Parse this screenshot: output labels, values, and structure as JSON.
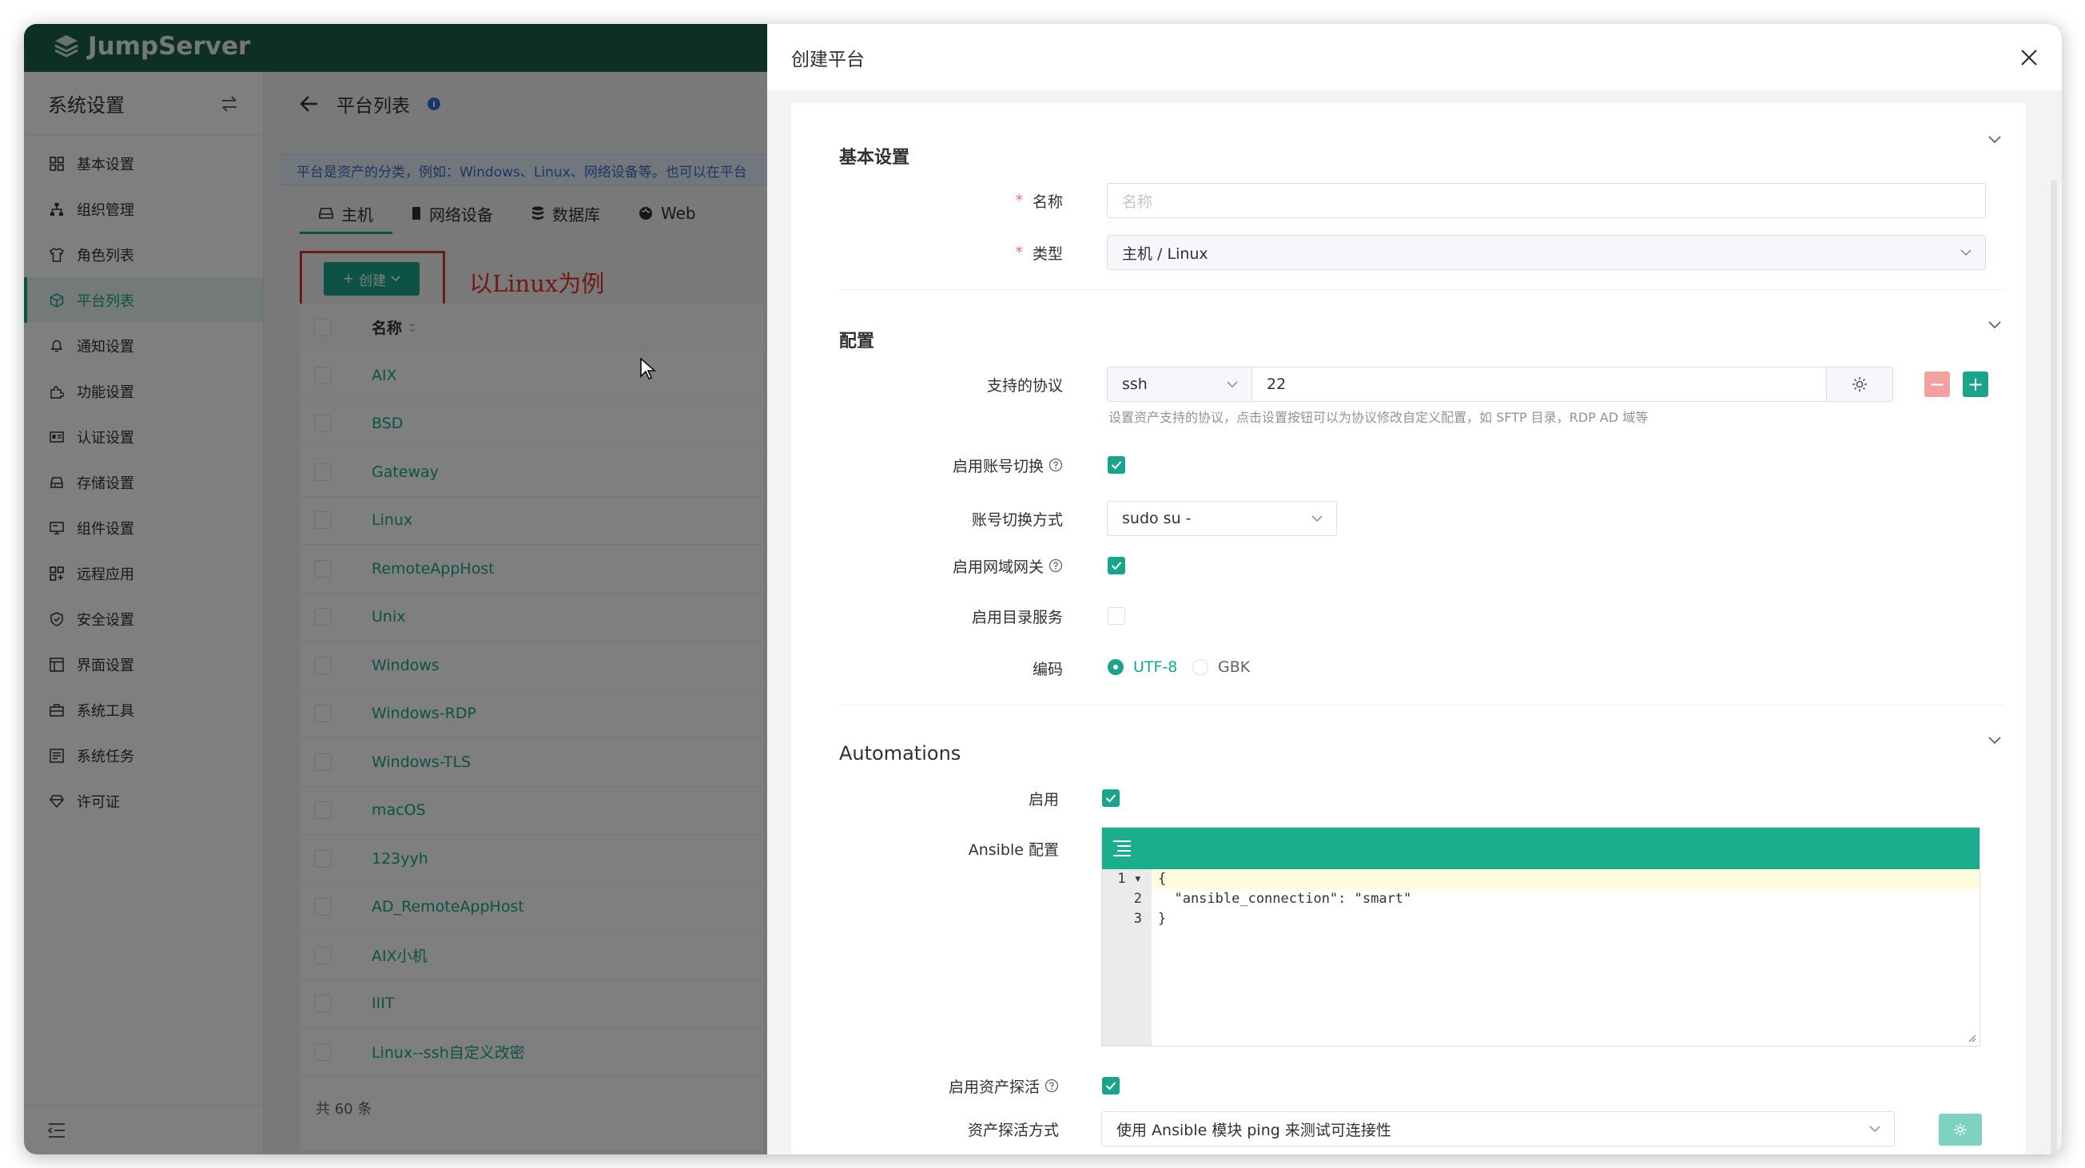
{
  "app": {
    "logo_text": "JumpServer"
  },
  "sidebar": {
    "title": "系统设置",
    "items": [
      {
        "label": "基本设置",
        "icon": "grid-icon"
      },
      {
        "label": "组织管理",
        "icon": "org-tree-icon"
      },
      {
        "label": "角色列表",
        "icon": "tshirt-icon"
      },
      {
        "label": "平台列表",
        "icon": "cube-icon",
        "active": true
      },
      {
        "label": "通知设置",
        "icon": "bell-icon"
      },
      {
        "label": "功能设置",
        "icon": "puzzle-icon"
      },
      {
        "label": "认证设置",
        "icon": "id-card-icon"
      },
      {
        "label": "存储设置",
        "icon": "storage-icon"
      },
      {
        "label": "组件设置",
        "icon": "monitor-icon"
      },
      {
        "label": "远程应用",
        "icon": "apps-icon"
      },
      {
        "label": "安全设置",
        "icon": "shield-icon"
      },
      {
        "label": "界面设置",
        "icon": "layout-icon"
      },
      {
        "label": "系统工具",
        "icon": "toolbox-icon"
      },
      {
        "label": "系统任务",
        "icon": "task-list-icon"
      },
      {
        "label": "许可证",
        "icon": "diamond-icon"
      }
    ]
  },
  "page": {
    "title": "平台列表",
    "notice": "平台是资产的分类，例如：Windows、Linux、网络设备等。也可以在平台",
    "tabs": [
      {
        "label": "主机",
        "icon": "host-icon",
        "active": true
      },
      {
        "label": "网络设备",
        "icon": "device-icon"
      },
      {
        "label": "数据库",
        "icon": "database-icon"
      },
      {
        "label": "Web",
        "icon": "globe-icon"
      }
    ],
    "create_label": "创建",
    "annotation": "以Linux为例",
    "table": {
      "name_header": "名称",
      "rows": [
        "AIX",
        "BSD",
        "Gateway",
        "Linux",
        "RemoteAppHost",
        "Unix",
        "Windows",
        "Windows-RDP",
        "Windows-TLS",
        "macOS",
        "123yyh",
        "AD_RemoteAppHost",
        "AIX小机",
        "IIIT",
        "Linux--ssh自定义改密"
      ],
      "total": "共 60 条"
    }
  },
  "drawer": {
    "title": "创建平台",
    "basic": {
      "title": "基本设置",
      "name_label": "名称",
      "name_placeholder": "名称",
      "type_label": "类型",
      "type_value": "主机 / Linux"
    },
    "config": {
      "title": "配置",
      "protocol_label": "支持的协议",
      "protocol_value": "ssh",
      "port_value": "22",
      "protocol_hint": "设置资产支持的协议，点击设置按钮可以为协议修改自定义配置，如 SFTP 目录，RDP AD 域等",
      "su_enabled_label": "启用账号切换",
      "su_method_label": "账号切换方式",
      "su_method_value": "sudo su -",
      "gateway_label": "启用网域网关",
      "ds_label": "启用目录服务",
      "charset_label": "编码",
      "charset_options": [
        "UTF-8",
        "GBK"
      ]
    },
    "automations": {
      "title": "Automations",
      "enable_label": "启用",
      "ansible_label": "Ansible 配置",
      "code_lines": [
        "{",
        "  \"ansible_connection\": \"smart\"",
        "}"
      ],
      "ping_enabled_label": "启用资产探活",
      "ping_method_label": "资产探活方式",
      "ping_method_value": "使用 Ansible 模块 ping 来测试可连接性"
    }
  },
  "colors": {
    "accent": "#1aa48b",
    "header": "#1b5e4a",
    "annotation": "#e0322e",
    "danger_btn": "#f3a0a0"
  }
}
